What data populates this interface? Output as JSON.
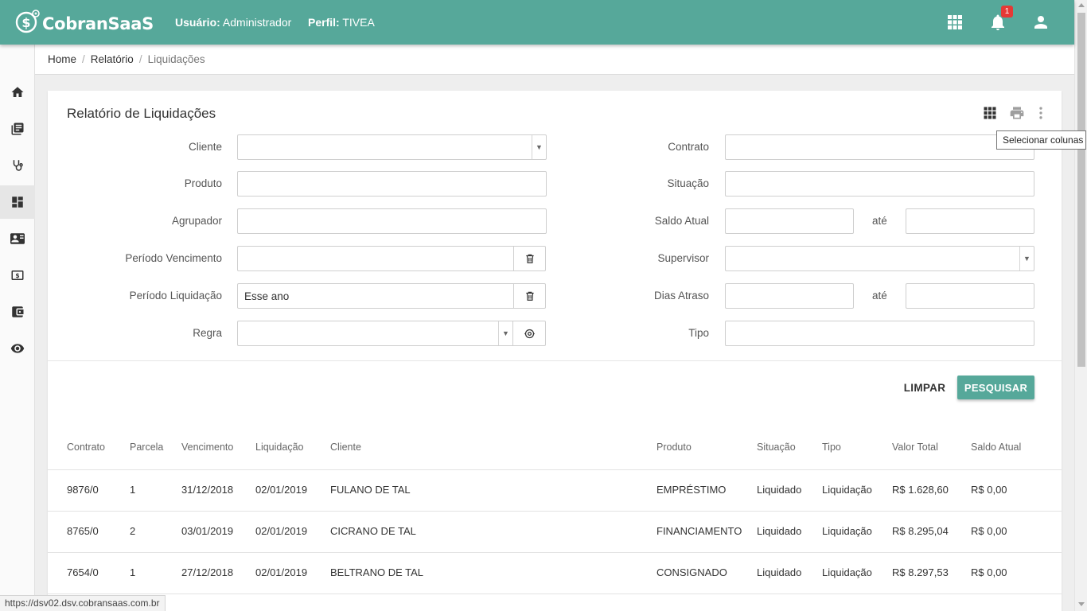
{
  "app": {
    "name": "CobranSaaS"
  },
  "header": {
    "user_label": "Usuário:",
    "user_value": "Administrador",
    "profile_label": "Perfil:",
    "profile_value": "TIVEA",
    "notification_count": "1"
  },
  "breadcrumb": {
    "home": "Home",
    "report": "Relatório",
    "current": "Liquidações"
  },
  "card": {
    "title": "Relatório de Liquidações",
    "tooltip": "Selecionar colunas"
  },
  "filters": {
    "cliente": {
      "label": "Cliente",
      "value": ""
    },
    "produto": {
      "label": "Produto",
      "value": ""
    },
    "agrupador": {
      "label": "Agrupador",
      "value": ""
    },
    "periodo_vencimento": {
      "label": "Período Vencimento",
      "value": ""
    },
    "periodo_liquidacao": {
      "label": "Período Liquidação",
      "value": "Esse ano"
    },
    "regra": {
      "label": "Regra",
      "value": ""
    },
    "contrato": {
      "label": "Contrato",
      "value": ""
    },
    "situacao": {
      "label": "Situação",
      "value": ""
    },
    "saldo_atual": {
      "label": "Saldo Atual",
      "from": "",
      "to": ""
    },
    "supervisor": {
      "label": "Supervisor",
      "value": ""
    },
    "dias_atraso": {
      "label": "Dias Atraso",
      "from": "",
      "to": ""
    },
    "tipo": {
      "label": "Tipo",
      "value": ""
    },
    "range_separator": "até"
  },
  "actions": {
    "clear": "LIMPAR",
    "search": "PESQUISAR"
  },
  "table": {
    "columns": [
      "Contrato",
      "Parcela",
      "Vencimento",
      "Liquidação",
      "Cliente",
      "Produto",
      "Situação",
      "Tipo",
      "Valor Total",
      "Saldo Atual"
    ],
    "rows": [
      [
        "9876/0",
        "1",
        "31/12/2018",
        "02/01/2019",
        "FULANO DE TAL",
        "EMPRÉSTIMO",
        "Liquidado",
        "Liquidação",
        "R$ 1.628,60",
        "R$ 0,00"
      ],
      [
        "8765/0",
        "2",
        "03/01/2019",
        "02/01/2019",
        "CICRANO DE TAL",
        "FINANCIAMENTO",
        "Liquidado",
        "Liquidação",
        "R$ 8.295,04",
        "R$ 0,00"
      ],
      [
        "7654/0",
        "1",
        "27/12/2018",
        "02/01/2019",
        "BELTRANO DE TAL",
        "CONSIGNADO",
        "Liquidado",
        "Liquidação",
        "R$ 8.297,53",
        "R$ 0,00"
      ]
    ]
  },
  "status_url": "https://dsv02.dsv.cobransaas.com.br",
  "colors": {
    "primary": "#56a89a",
    "badge": "#e53935"
  }
}
